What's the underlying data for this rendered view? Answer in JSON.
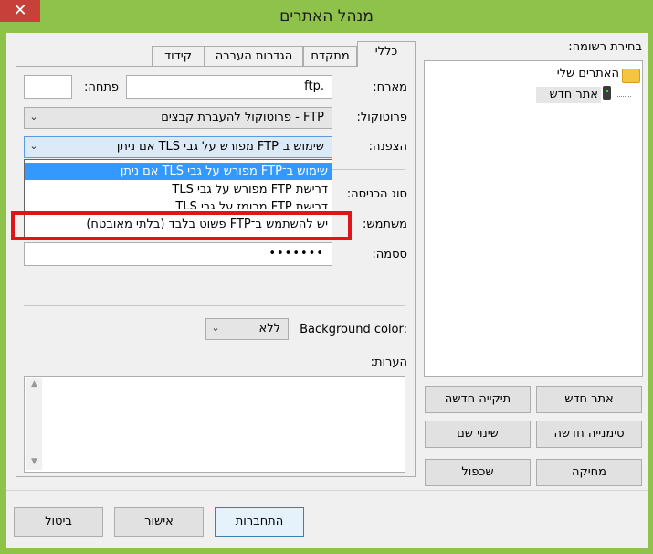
{
  "window": {
    "title": "מנהל האתרים",
    "close_glyph": "✕"
  },
  "tree": {
    "label": "בחירת רשומה:",
    "root": "האתרים שלי",
    "child": "אתר חדש"
  },
  "left_buttons": {
    "new_site": "אתר חדש",
    "new_folder": "תיקייה חדשה",
    "new_bookmark": "סימנייה חדשה",
    "rename": "שינוי שם",
    "delete": "מחיקה",
    "duplicate": "שכפול"
  },
  "tabs": [
    "כללי",
    "מתקדם",
    "הגדרות העברה",
    "קידוד"
  ],
  "general": {
    "host_label": "מארח:",
    "host_value": "ftp.",
    "port_label": "פתחה:",
    "port_value": "",
    "protocol_label": "פרוטוקול:",
    "protocol_value": "FTP - פרוטוקול להעברת קבצים",
    "encryption_label": "הצפנה:",
    "encryption_value": "שימוש ב־FTP מפורש על גבי TLS אם ניתן",
    "logon_label": "סוג הכניסה:",
    "user_label": "משתמש:",
    "password_label": "ססמה:",
    "password_value": "•••••••",
    "bgcolor_label": "Background color:",
    "bgcolor_value": "ללא",
    "comments_label": "הערות:"
  },
  "encryption_options": [
    "שימוש ב־FTP מפורש על גבי TLS אם ניתן",
    "דרישת FTP מפורש על גבי TLS",
    "דרישת FTP מרומז על גבי TLS",
    "יש להשתמש ב־FTP פשוט בלבד (בלתי מאובטח)"
  ],
  "bottom_buttons": {
    "connect": "התחברות",
    "ok": "אישור",
    "cancel": "ביטול"
  },
  "colors": {
    "title_bar": "#8fc24a",
    "highlight": "#3399ff",
    "annotation": "#e0141b"
  }
}
